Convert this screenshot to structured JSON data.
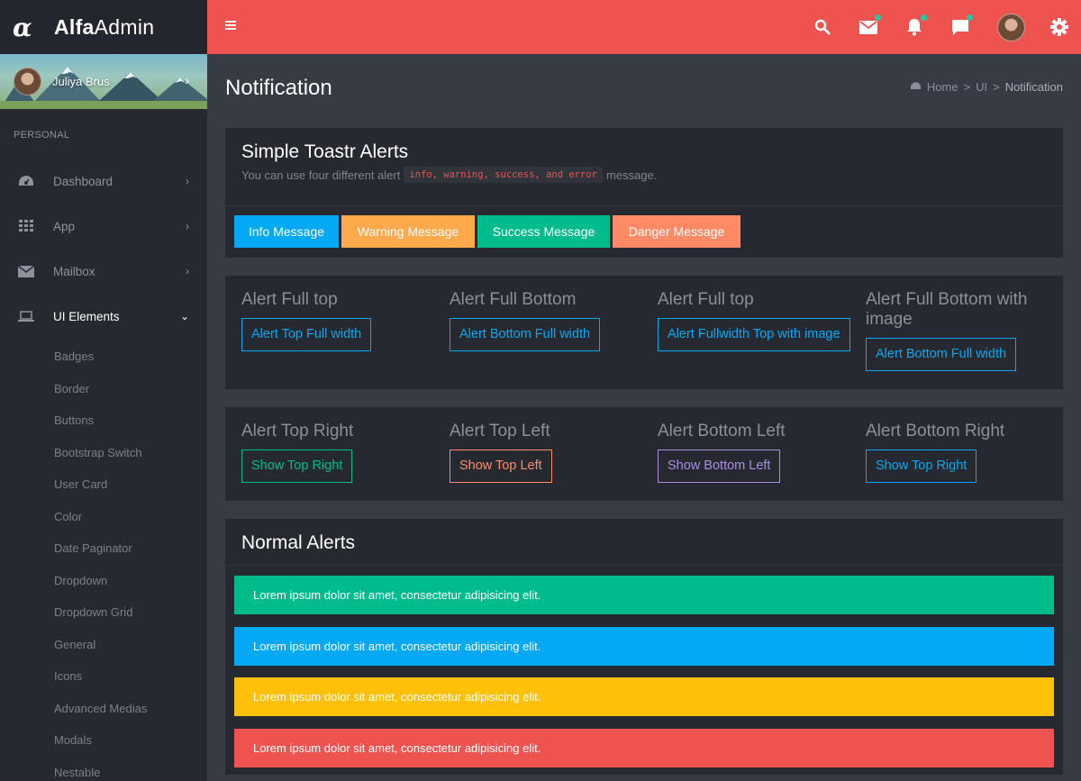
{
  "app": {
    "logo_glyph": "α",
    "logo_bold": "Alfa",
    "logo_light": "Admin"
  },
  "user": {
    "name": "Juliya Brus"
  },
  "sidebar": {
    "section_header": "PERSONAL",
    "items": [
      {
        "label": "Dashboard",
        "icon": "dashboard-icon"
      },
      {
        "label": "App",
        "icon": "grid-icon"
      },
      {
        "label": "Mailbox",
        "icon": "mail-icon"
      },
      {
        "label": "UI Elements",
        "icon": "laptop-icon",
        "expanded": true
      }
    ],
    "submenu": [
      "Badges",
      "Border",
      "Buttons",
      "Bootstrap Switch",
      "User Card",
      "Color",
      "Date Paginator",
      "Dropdown",
      "Dropdown Grid",
      "General",
      "Icons",
      "Advanced Medias",
      "Modals",
      "Nestable"
    ]
  },
  "topbar": {
    "icons": [
      "menu-icon",
      "search-icon",
      "mail-icon",
      "bell-icon",
      "chat-icon",
      "avatar",
      "gear-icon"
    ],
    "color": "#ef5350"
  },
  "page": {
    "title": "Notification",
    "breadcrumb": [
      "Home",
      "UI",
      "Notification"
    ]
  },
  "toastr": {
    "title": "Simple Toastr Alerts",
    "subtitle_prefix": "You can use four different alert",
    "code": "info, warning, success, and error",
    "subtitle_suffix": "message.",
    "buttons": [
      {
        "label": "Info Message",
        "color": "#03a9f4"
      },
      {
        "label": "Warning Message",
        "color": "#ffa94d"
      },
      {
        "label": "Success Message",
        "color": "#00bc8c"
      },
      {
        "label": "Danger Message",
        "color": "#ff8a65"
      }
    ]
  },
  "full_alerts": [
    {
      "title": "Alert Full top",
      "button": "Alert Top Full width"
    },
    {
      "title": "Alert Full Bottom",
      "button": "Alert Bottom Full width"
    },
    {
      "title": "Alert Full top",
      "button": "Alert Fullwidth Top with image"
    },
    {
      "title": "Alert Full Bottom with image",
      "button": "Alert Bottom Full width"
    }
  ],
  "position_alerts": [
    {
      "title": "Alert Top Right",
      "button": "Show Top Right",
      "color": "#00bc8c"
    },
    {
      "title": "Alert Top Left",
      "button": "Show Top Left",
      "color": "#ff8a65"
    },
    {
      "title": "Alert Bottom Left",
      "button": "Show Bottom Left",
      "color": "#ab8ce4"
    },
    {
      "title": "Alert Bottom Right",
      "button": "Show Top Right",
      "color": "#03a9f4"
    }
  ],
  "normal_alerts": {
    "title": "Normal Alerts",
    "items": [
      {
        "text": "Lorem ipsum dolor sit amet, consectetur adipisicing elit.",
        "color": "#00bc8c"
      },
      {
        "text": "Lorem ipsum dolor sit amet, consectetur adipisicing elit.",
        "color": "#03a9f4"
      },
      {
        "text": "Lorem ipsum dolor sit amet, consectetur adipisicing elit.",
        "color": "#ffc107"
      },
      {
        "text": "Lorem ipsum dolor sit amet, consectetur adipisicing elit.",
        "color": "#ef5350"
      }
    ]
  }
}
